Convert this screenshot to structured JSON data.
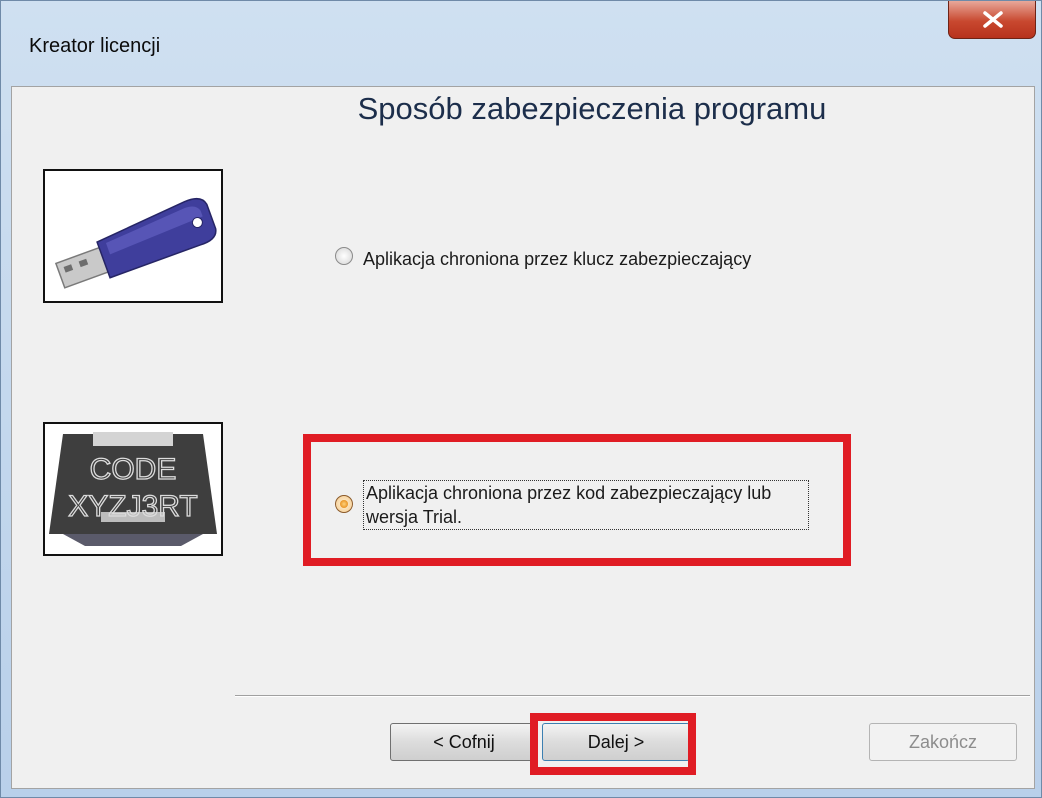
{
  "window": {
    "title": "Kreator licencji"
  },
  "page": {
    "heading": "Sposób zabezpieczenia programu"
  },
  "options": [
    {
      "label": "Aplikacja chroniona przez klucz zabezpieczający",
      "selected": false
    },
    {
      "label": "Aplikacja chroniona przez kod zabezpieczający lub wersja Trial.",
      "selected": true
    }
  ],
  "images": {
    "code_line1": "CODE",
    "code_line2": "XYZJ3RT"
  },
  "buttons": {
    "back": "< Cofnij",
    "next": "Dalej >",
    "finish": "Zakończ"
  },
  "colors": {
    "highlight": "#e01c24",
    "heading": "#1c2e4b"
  }
}
